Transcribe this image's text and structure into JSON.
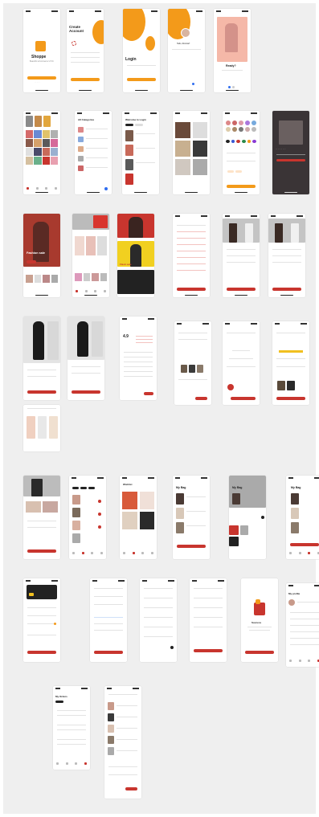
{
  "colors": {
    "accent": "#c8352e",
    "orange": "#f39a1a",
    "board": "#efefef"
  },
  "screens": {
    "shoppe": {
      "title": "Shoppe",
      "subtitle": "Beautiful eCommerce UI Kit"
    },
    "create_account": {
      "title": "Create Account"
    },
    "login": {
      "title": "Login"
    },
    "password": {
      "greeting": "Hello, Romina!!"
    },
    "ready": {
      "title": "Ready?"
    },
    "categories": {
      "title": "All Categories"
    },
    "welcome": {
      "title": "Welcome to Login"
    },
    "fashion": {
      "title": "Fashion sale"
    },
    "flash": {
      "title": "Flash sale"
    },
    "reviews": {
      "rating": "4.9"
    },
    "wishlist": {
      "title": "Wishlist"
    },
    "my_bag": {
      "title": "My Bag"
    },
    "success": {
      "title": "Success"
    },
    "profile": {
      "title": "My profile"
    },
    "orders": {
      "title": "My Orders"
    }
  }
}
